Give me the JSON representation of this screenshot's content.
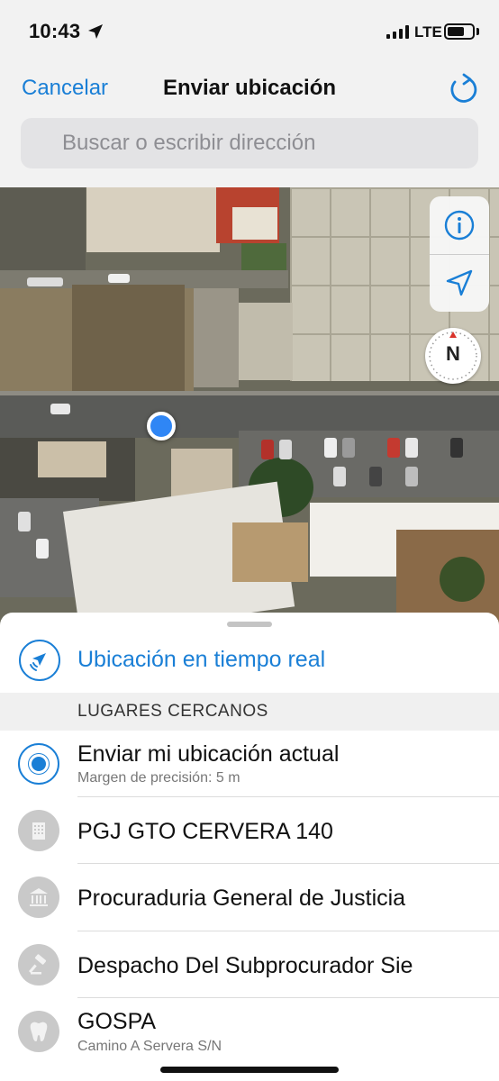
{
  "status_bar": {
    "time": "10:43",
    "network": "LTE",
    "signal_bars": 4,
    "battery_level": 0.65
  },
  "nav": {
    "cancel_label": "Cancelar",
    "title": "Enviar ubicación"
  },
  "search": {
    "placeholder": "Buscar o escribir dirección"
  },
  "map": {
    "compass_label": "N",
    "controls": [
      "info-icon",
      "location-arrow-icon"
    ]
  },
  "sheet": {
    "live_location_label": "Ubicación en tiempo real",
    "section_header": "LUGARES CERCANOS",
    "places": [
      {
        "name": "Enviar mi ubicación actual",
        "subtitle": "Margen de precisión: 5 m",
        "icon": "current-location-icon"
      },
      {
        "name": "PGJ GTO CERVERA 140",
        "subtitle": "",
        "icon": "building-icon"
      },
      {
        "name": "Procuraduria General de Justicia",
        "subtitle": "",
        "icon": "courthouse-icon"
      },
      {
        "name": "Despacho Del Subprocurador Sie",
        "subtitle": "",
        "icon": "gavel-icon"
      },
      {
        "name": "GOSPA",
        "subtitle": "Camino A Servera S/N",
        "icon": "tooth-icon"
      }
    ]
  },
  "colors": {
    "accent": "#1a7fd6",
    "user_dot": "#2f86f5",
    "place_icon_bg": "#c9c9c9"
  }
}
